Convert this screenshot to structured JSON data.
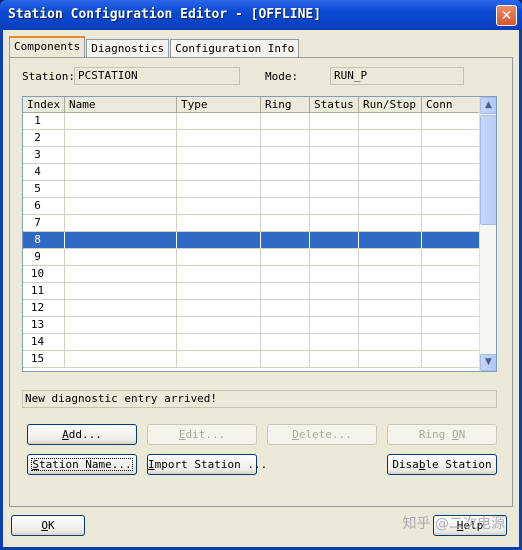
{
  "window": {
    "title": "Station Configuration Editor - [OFFLINE]"
  },
  "tabs": [
    {
      "label": "Components"
    },
    {
      "label": "Diagnostics"
    },
    {
      "label": "Configuration Info"
    }
  ],
  "station": {
    "label": "Station:",
    "value": "PCSTATION"
  },
  "mode": {
    "label": "Mode:",
    "value": "RUN_P"
  },
  "grid": {
    "columns": [
      "Index",
      "Name",
      "Type",
      "Ring",
      "Status",
      "Run/Stop",
      "Conn"
    ],
    "rows": [
      "1",
      "2",
      "3",
      "4",
      "5",
      "6",
      "7",
      "8",
      "9",
      "10",
      "11",
      "12",
      "13",
      "14",
      "15"
    ],
    "selected_row": "8"
  },
  "status_message": "New diagnostic entry arrived!",
  "buttons": {
    "add": {
      "pre": "",
      "u": "A",
      "post": "dd..."
    },
    "edit": {
      "pre": "",
      "u": "E",
      "post": "dit..."
    },
    "delete": {
      "pre": "",
      "u": "D",
      "post": "elete..."
    },
    "ring_on": {
      "pre": "Ring ",
      "u": "O",
      "post": "N"
    },
    "station_name": {
      "pre": "",
      "u": "S",
      "post": "tation Name..."
    },
    "import_station": {
      "pre": "",
      "u": "I",
      "post": "mport Station ..."
    },
    "disable_station": {
      "pre": "Disa",
      "u": "b",
      "post": "le Station"
    },
    "ok": {
      "pre": "",
      "u": "O",
      "post": "K"
    },
    "help": {
      "pre": "",
      "u": "H",
      "post": "elp"
    }
  },
  "watermark": "知乎 @二次电源"
}
